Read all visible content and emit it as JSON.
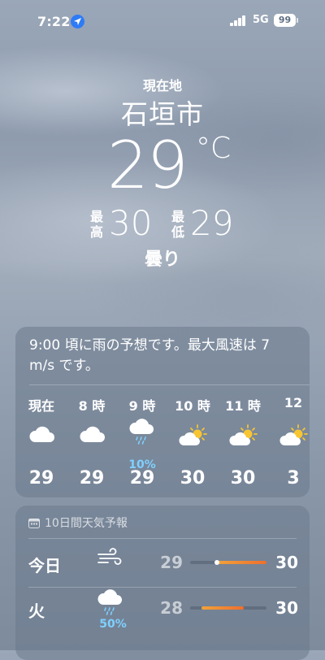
{
  "status_bar": {
    "time": "7:22",
    "network": "5G",
    "battery": "99"
  },
  "header": {
    "location_label": "現在地",
    "city": "石垣市",
    "temperature": "29",
    "unit": "°C",
    "high_label_top": "最",
    "high_label_bottom": "高",
    "high": "30",
    "low_label_top": "最",
    "low_label_bottom": "低",
    "low": "29",
    "condition": "曇り"
  },
  "hourly": {
    "summary": "9:00 頃に雨の予想です。最大風速は 7 m/s です。",
    "hours": [
      {
        "label": "現在",
        "icon": "cloud-icon",
        "precip": "",
        "temp": "29"
      },
      {
        "label": "8 時",
        "icon": "cloud-icon",
        "precip": "",
        "temp": "29"
      },
      {
        "label": "9 時",
        "icon": "rain-cloud-icon",
        "precip": "10%",
        "temp": "29"
      },
      {
        "label": "10 時",
        "icon": "partly-sunny-icon",
        "precip": "",
        "temp": "30"
      },
      {
        "label": "11 時",
        "icon": "partly-sunny-icon",
        "precip": "",
        "temp": "30"
      },
      {
        "label": "12",
        "icon": "partly-sunny-icon",
        "precip": "",
        "temp": "3"
      }
    ]
  },
  "daily": {
    "header": "10日間天気予報",
    "days": [
      {
        "name": "今日",
        "icon": "wind-icon",
        "precip": "",
        "low": "29",
        "high": "30",
        "range_start": 0.35,
        "range_end": 1.0,
        "current": 0.35
      },
      {
        "name": "火",
        "icon": "rain-cloud-icon",
        "precip": "50%",
        "low": "28",
        "high": "30",
        "range_start": 0.15,
        "range_end": 0.7,
        "current": null
      }
    ]
  },
  "colors": {
    "precip_text": "#7fd0ff",
    "range_fill_start": "#f0a23a",
    "range_fill_end": "#ef6f2c",
    "location_arrow": "#2f7bf6"
  }
}
